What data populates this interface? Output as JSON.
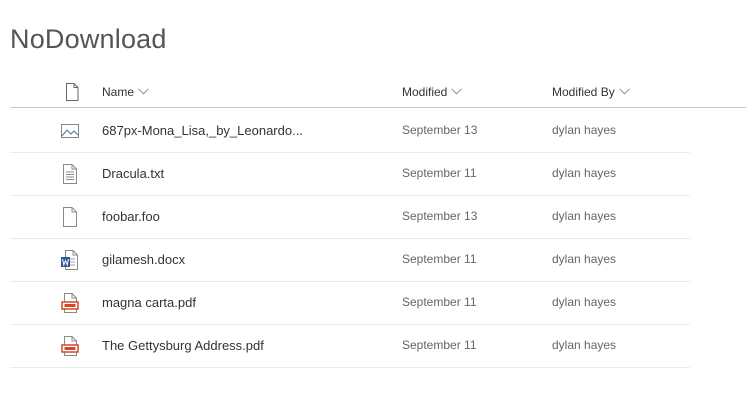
{
  "page": {
    "title": "NoDownload"
  },
  "columns": {
    "type_icon": "document-icon",
    "name": "Name",
    "modified": "Modified",
    "modified_by": "Modified By"
  },
  "colors": {
    "word_blue": "#2b579a",
    "pdf_red": "#d24726",
    "image_teal": "#5a7a8a",
    "icon_gray": "#8a8a8a"
  },
  "files": [
    {
      "icon": "image-file-icon",
      "name": "687px-Mona_Lisa,_by_Leonardo...",
      "modified": "September 13",
      "modified_by": "dylan hayes"
    },
    {
      "icon": "text-file-icon",
      "name": "Dracula.txt",
      "modified": "September 11",
      "modified_by": "dylan hayes"
    },
    {
      "icon": "generic-file-icon",
      "name": "foobar.foo",
      "modified": "September 13",
      "modified_by": "dylan hayes"
    },
    {
      "icon": "word-file-icon",
      "name": "gilamesh.docx",
      "modified": "September 11",
      "modified_by": "dylan hayes"
    },
    {
      "icon": "pdf-file-icon",
      "name": "magna carta.pdf",
      "modified": "September 11",
      "modified_by": "dylan hayes"
    },
    {
      "icon": "pdf-file-icon",
      "name": "The Gettysburg Address.pdf",
      "modified": "September 11",
      "modified_by": "dylan hayes"
    }
  ]
}
